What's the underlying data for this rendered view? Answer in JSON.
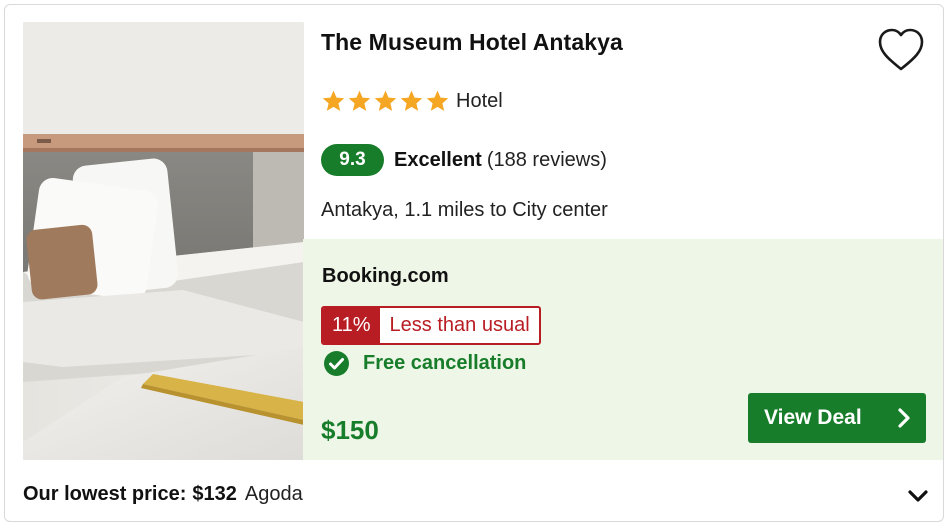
{
  "hotel": {
    "name": "The Museum Hotel Antakya",
    "star_count": 5,
    "property_type": "Hotel",
    "score": "9.3",
    "rating_word": "Excellent",
    "reviews": "(188 reviews)",
    "location": "Antakya, 1.1 miles to City center"
  },
  "deal": {
    "provider": "Booking.com",
    "discount_pct": "11%",
    "discount_text": "Less than usual",
    "cancellation": "Free cancellation",
    "price": "$150",
    "button_label": "View Deal"
  },
  "footer": {
    "lowest_label": "Our lowest price:",
    "lowest_price": "$132",
    "lowest_provider": "Agoda"
  },
  "icons": {
    "favorite": "heart-outline-icon",
    "star": "star-icon",
    "check": "check-circle-icon",
    "cta_arrow": "chevron-right-icon",
    "expand": "chevron-down-icon"
  },
  "colors": {
    "brand_green": "#177d2a",
    "deal_bg": "#eef6e7",
    "discount_red": "#b81d24",
    "star_orange": "#f5a623"
  }
}
